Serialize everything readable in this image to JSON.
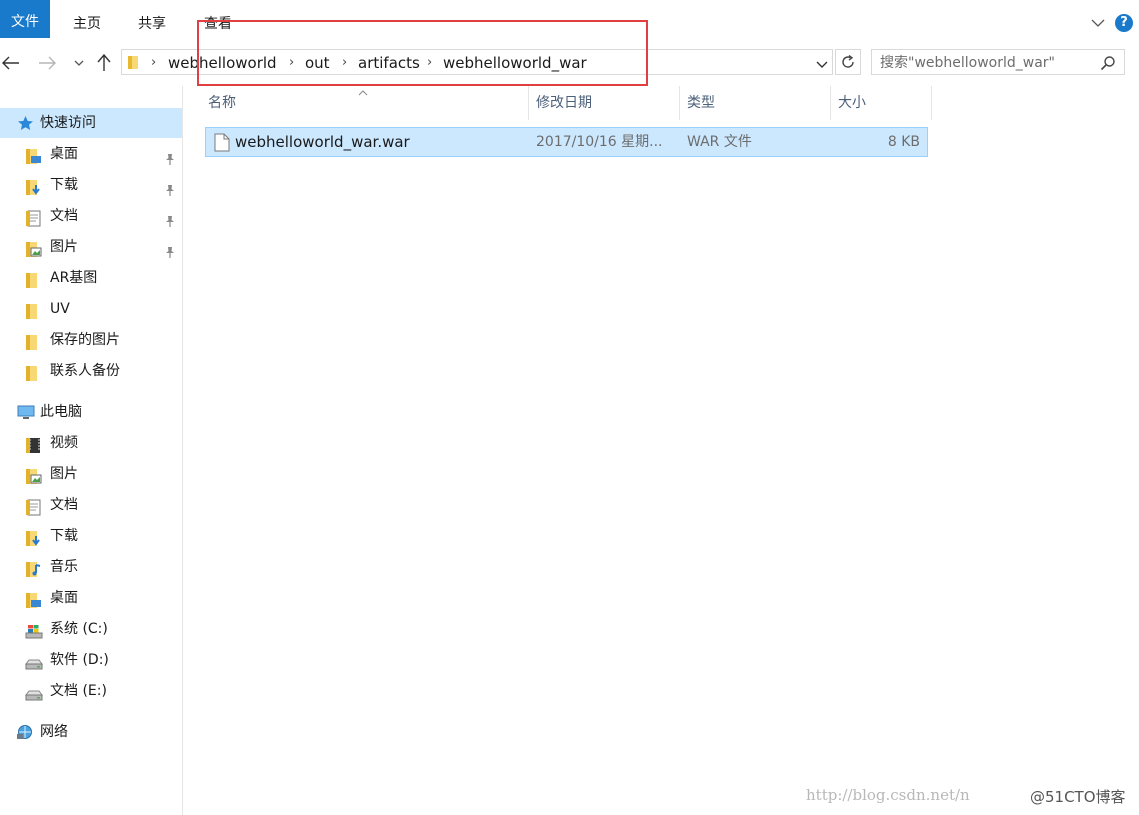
{
  "ribbon": {
    "tabs": [
      "文件",
      "主页",
      "共享",
      "查看"
    ]
  },
  "address": {
    "crumbs": [
      "webhelloworld",
      "out",
      "artifacts",
      "webhelloworld_war"
    ],
    "separator": "›"
  },
  "search": {
    "placeholder": "搜索\"webhelloworld_war\""
  },
  "nav": {
    "quick_access": "快速访问",
    "quick_items": [
      {
        "label": "桌面",
        "icon": "desktop-folder-icon",
        "pinned": true
      },
      {
        "label": "下载",
        "icon": "downloads-folder-icon",
        "pinned": true
      },
      {
        "label": "文档",
        "icon": "documents-folder-icon",
        "pinned": true
      },
      {
        "label": "图片",
        "icon": "pictures-folder-icon",
        "pinned": true
      },
      {
        "label": "AR基图",
        "icon": "folder-icon",
        "pinned": false
      },
      {
        "label": "UV",
        "icon": "folder-icon",
        "pinned": false
      },
      {
        "label": "保存的图片",
        "icon": "folder-icon",
        "pinned": false
      },
      {
        "label": "联系人备份",
        "icon": "folder-icon",
        "pinned": false
      }
    ],
    "this_pc": "此电脑",
    "pc_items": [
      {
        "label": "视频",
        "icon": "videos-folder-icon"
      },
      {
        "label": "图片",
        "icon": "pictures-folder-icon"
      },
      {
        "label": "文档",
        "icon": "documents-folder-icon"
      },
      {
        "label": "下载",
        "icon": "downloads-folder-icon"
      },
      {
        "label": "音乐",
        "icon": "music-folder-icon"
      },
      {
        "label": "桌面",
        "icon": "desktop-folder-icon"
      },
      {
        "label": "系统 (C:)",
        "icon": "system-drive-icon"
      },
      {
        "label": "软件 (D:)",
        "icon": "drive-icon"
      },
      {
        "label": "文档 (E:)",
        "icon": "drive-icon"
      }
    ],
    "network": "网络"
  },
  "columns": {
    "name": "名称",
    "modified": "修改日期",
    "type": "类型",
    "size": "大小"
  },
  "files": [
    {
      "name": "webhelloworld_war.war",
      "modified": "2017/10/16 星期...",
      "type": "WAR 文件",
      "size": "8 KB"
    }
  ],
  "watermark": {
    "url": "http://blog.csdn.net/n",
    "brand": "@51CTO博客"
  },
  "colors": {
    "accent": "#1979ca",
    "selection": "#cce8ff",
    "highlight_frame": "#e0403f"
  }
}
